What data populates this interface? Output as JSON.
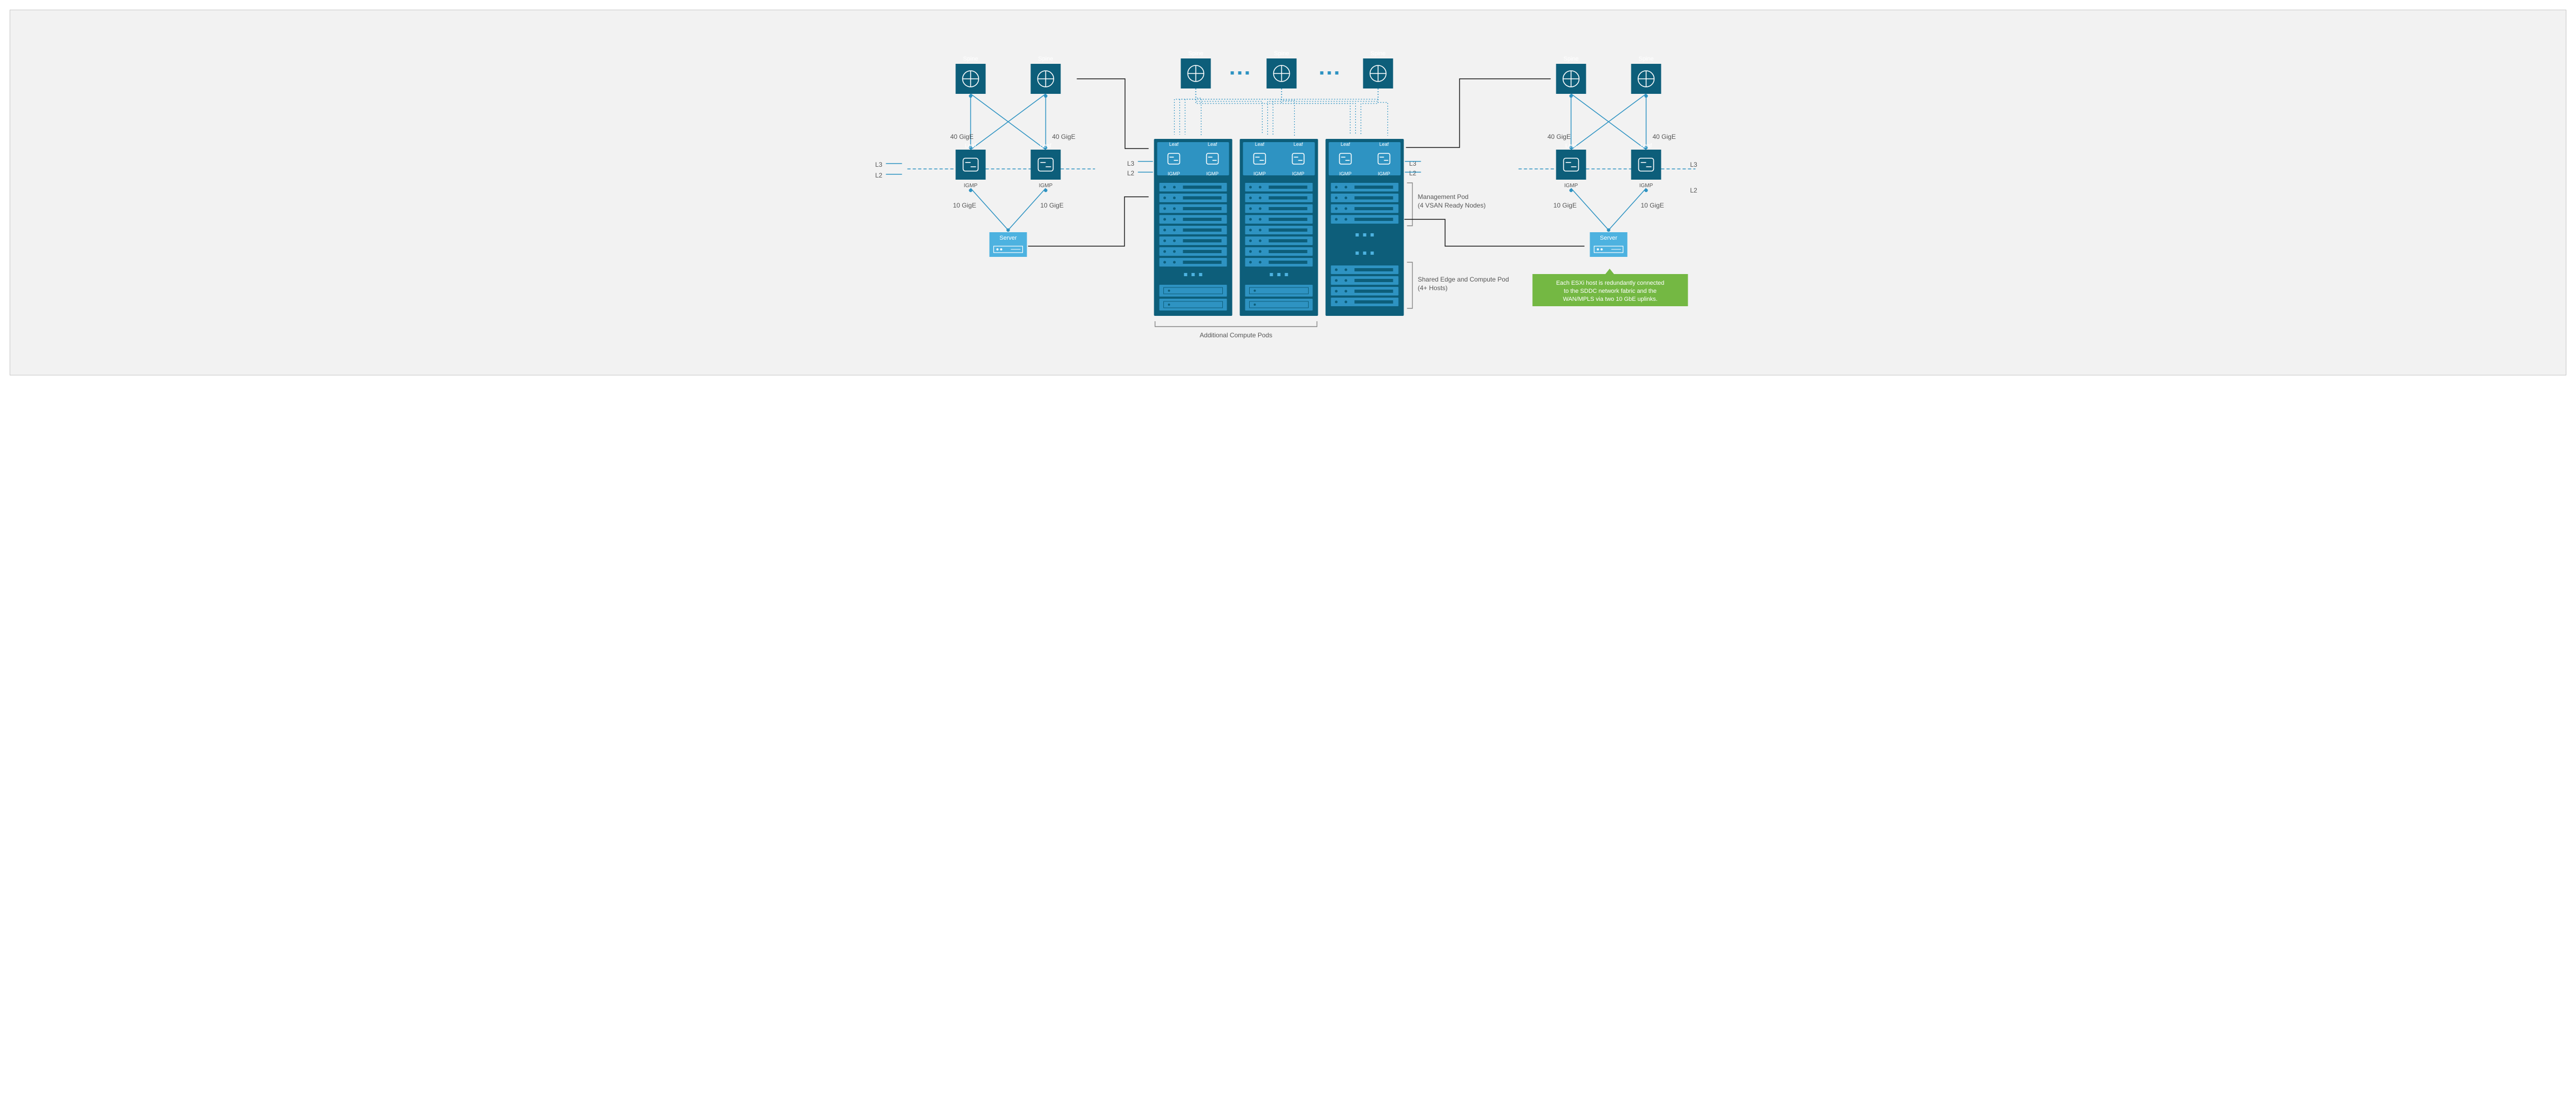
{
  "labels": {
    "spine": "Spine",
    "leaf": "Leaf",
    "igmp": "IGMP",
    "server": "Server",
    "l3": "L3",
    "l2": "L2",
    "link40": "40 GigE",
    "link10": "10 GigE",
    "additional": "Additional Compute Pods",
    "mgmt1": "Management Pod",
    "mgmt2": "(4 VSAN Ready Nodes)",
    "edge1": "Shared Edge and Compute Pod",
    "edge2": "(4+ Hosts)",
    "tip1": "Each ESXi host is redundantly connected",
    "tip2": "to the SDDC network fabric and the",
    "tip3": "WAN/MPLS via two 10 GbE uplinks."
  }
}
